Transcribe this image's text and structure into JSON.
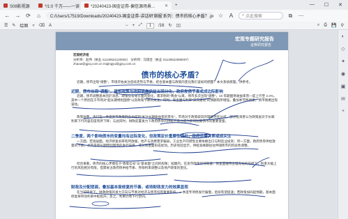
{
  "browser": {
    "tabs": [
      {
        "label": "S08影视源",
        "active": false
      },
      {
        "label": "*/1:0 千万——一读",
        "active": false
      },
      {
        "label": "*20240423-国金证券-偏信源场景...",
        "active": true
      }
    ],
    "address": "C:/Users/17519/Downloads/20240423-国金证券-讲话研'崩掘'系列：债市的核心矛盾？.pdf",
    "search_placeholder": "点此搜索"
  },
  "pdf_toolbar": {
    "draw_label": "绘图",
    "page_current": "1",
    "page_total": "/16"
  },
  "document": {
    "banner_title": "宏观专题研究报告",
    "banner_sub": "证券研究报告",
    "author_heading": "宏观经济组",
    "analysts_line": "分析师：赵伟（执业 S1130521120002）      分析师：马瑞宝（执业 S1130522080007）",
    "emails_line": "zhaow@gjzq.com.cn                               majingyu@gjzq.com.cn",
    "title": "债市的核心矛盾？",
    "intro": "近期，债市出现\"调整\"，市场开始关注后续走势与节奏，结合基本面与政策的变化我们该如何把握？本文系统梳理，供参考。",
    "heading1": "近期，债市出现\"调整\"，货币政策与政府债券供给出现分化，政府发债节奏或成边际影响",
    "para1": "近期，债市调整基本因於消息、政策信号等方面的变化，需求侧的\"两会\"以来，债市多次出现\"调整\"，10 年期国债收益率曾一度上行至 2.3%，其中一个原因在于市场对\"超长期特别国债\"以及政策节奏的关注；同时，资金面与利率\"双向波动\"的预期有所增强，叠加季节性因素，债市情绪出现波动。",
    "para2": "政策层面，央行在一季度货币政策例会中提到\"关注长期收益率的变化\"，市场对于政策取向的理解存在分歧，部分投资者认为政策层对于长端利率下行的容忍度有所下降；与此同时，财政前置发力下政府债券的供给节奏亦成为影响短期债市的重要变量。",
    "heading2": "二季度，两个影响债市的变量均有边际变化，但政策定价重要性提升，政府供需关系或成关注",
    "para3": "一方面，宏观层面，经济修复斜率有所放缓，地产与消费需求偏弱，工业生产的韧性主要依赖出口与制造业投资；另一方面，政府债券供给放量的节奏，尤其是超长期特别国债的发行安排，或对资金面形成扰动。历史经验显示，供给高峰期往往伴随债市的阶段性调整。",
    "para4": "综合来看，债市的核心矛盾在于\"政策信号\"与\"基本面\"之间的权衡；短期内，在货币政策保持稳健、资金面维持合理充裕的前提下，利率大幅上行的风险相对有限，但需关注政府债供给节奏、存款利率调整以及地产政策的变化。",
    "heading3": "财政及分配层面，叠加基本面修复的节奏，或待财政发力的效果显现",
    "para5": "在当前环境下，财政政策的发力方向与节奏对经济与债市均有重要影响，一季度专项债发行偏慢，后续有望提速；若政策加码超预期，基本面修复将带动利率中枢抬升；反之，利率仍有下行空间。"
  }
}
